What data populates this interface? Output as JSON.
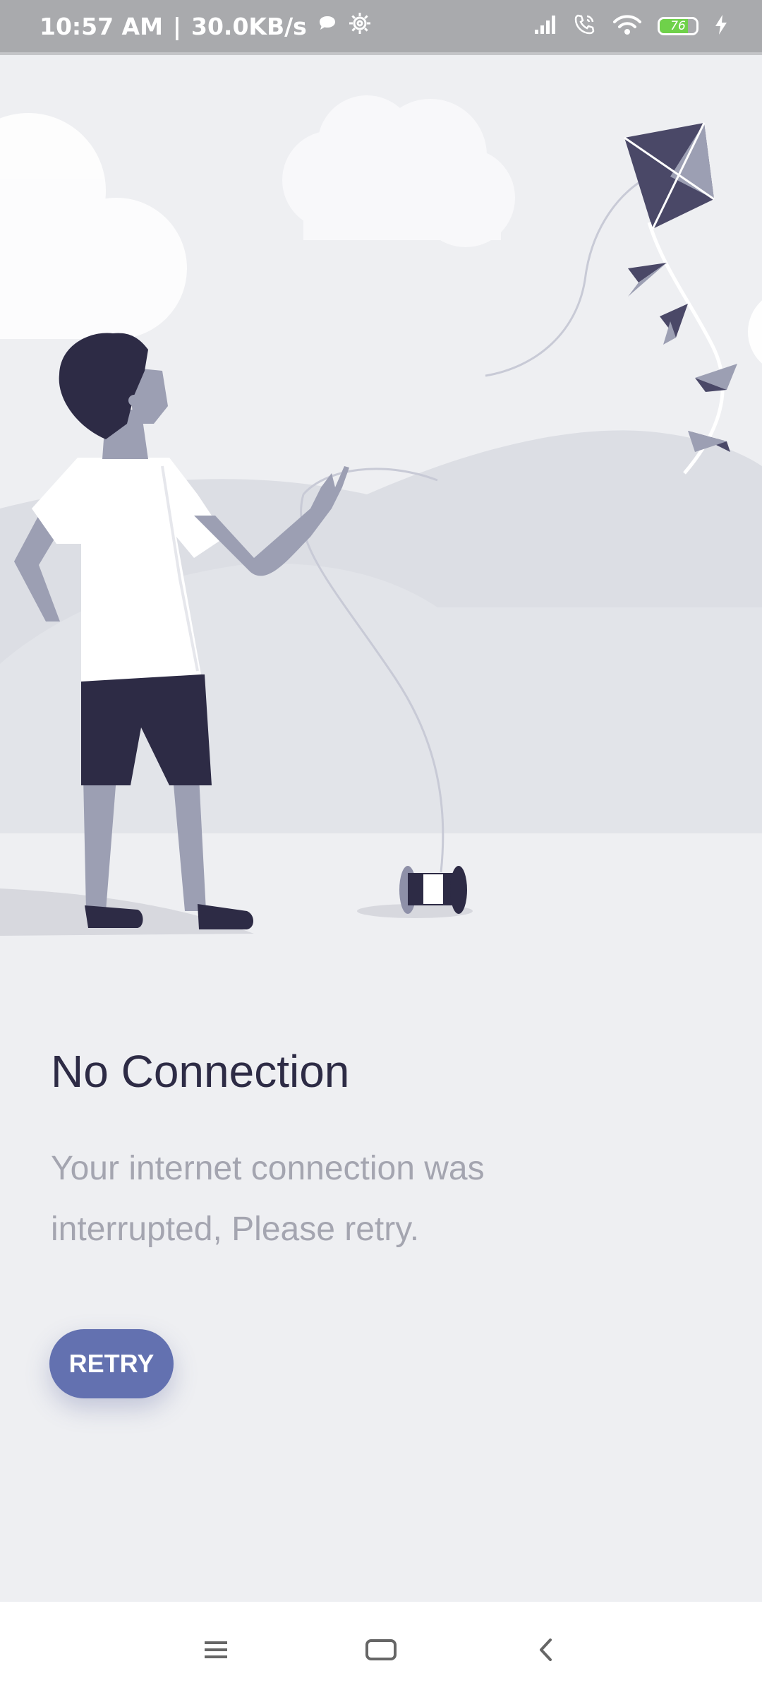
{
  "status_bar": {
    "time": "10:57 AM",
    "separator": "|",
    "speed": "30.0KB/s",
    "battery_level": "76",
    "icons": [
      "chat-bubble-icon",
      "settings-gear-icon",
      "signal-icon",
      "wifi-call-icon",
      "wifi-icon",
      "battery-icon",
      "charging-icon"
    ]
  },
  "illustration": {
    "description_icon": "kite-boy-illustration"
  },
  "error": {
    "title": "No Connection",
    "message": "Your internet connection was interrupted, Please retry."
  },
  "retry_button": {
    "label": "RETRY"
  },
  "nav_bar": {
    "icons": [
      "menu-icon",
      "home-icon",
      "back-icon"
    ]
  },
  "colors": {
    "accent": "#6371b0",
    "title": "#2d2b45",
    "subtitle": "#a4a5b0",
    "background": "#eeeff2"
  }
}
